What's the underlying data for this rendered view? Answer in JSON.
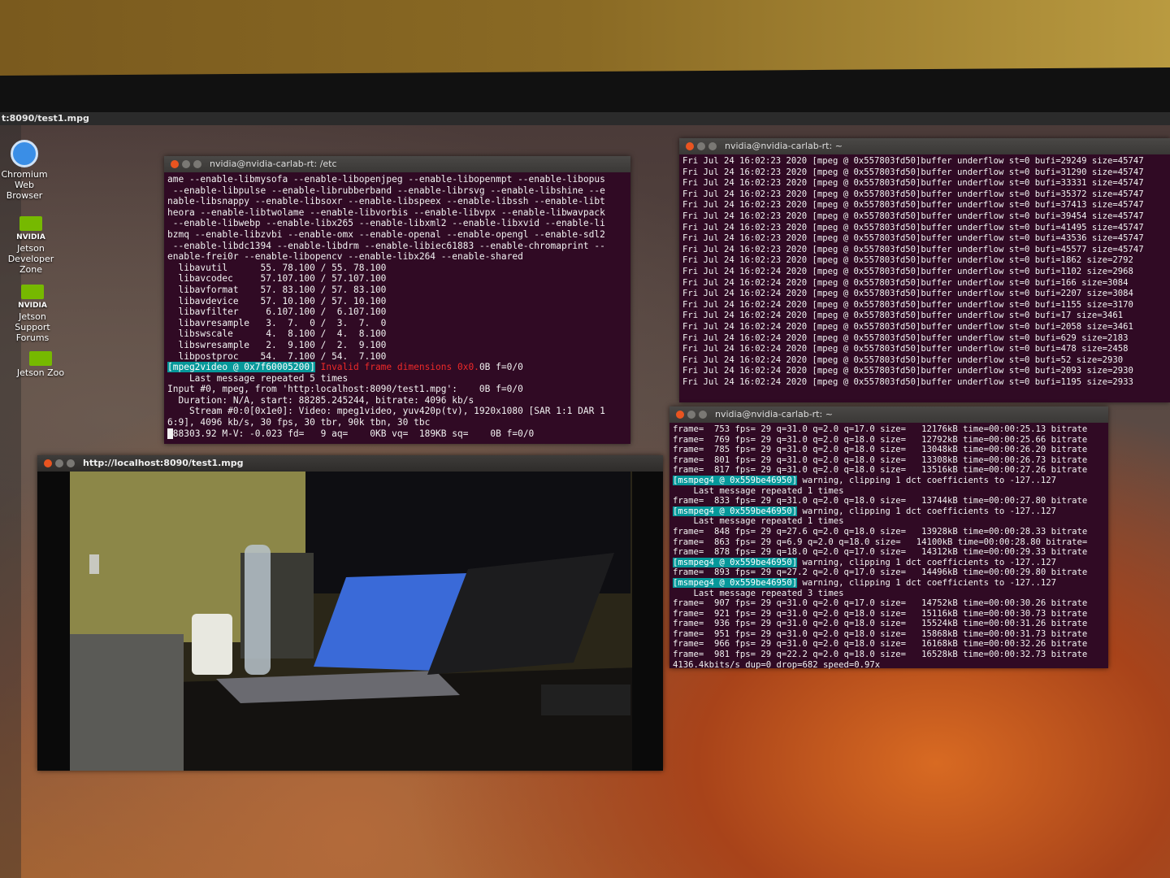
{
  "topbar": {
    "title": "t:8090/test1.mpg"
  },
  "desktop_icons": [
    {
      "label": "Chromium Web Browser",
      "icon": "chromium-icon"
    },
    {
      "label": "Jetson Developer Zone",
      "icon": "nvidia-icon",
      "brand": "NVIDIA"
    },
    {
      "label": "Jetson Support Forums",
      "icon": "nvidia-icon",
      "brand": "NVIDIA"
    },
    {
      "label": "Jetson Zoo",
      "icon": "nvidia-icon",
      "brand": "NVIDIA"
    }
  ],
  "terminal_etc": {
    "title": "nvidia@nvidia-carlab-rt: /etc",
    "lines": [
      "ame --enable-libmysofa --enable-libopenjpeg --enable-libopenmpt --enable-libopus",
      " --enable-libpulse --enable-librubberband --enable-librsvg --enable-libshine --e",
      "nable-libsnappy --enable-libsoxr --enable-libspeex --enable-libssh --enable-libt",
      "heora --enable-libtwolame --enable-libvorbis --enable-libvpx --enable-libwavpack",
      " --enable-libwebp --enable-libx265 --enable-libxml2 --enable-libxvid --enable-li",
      "bzmq --enable-libzvbi --enable-omx --enable-openal --enable-opengl --enable-sdl2",
      " --enable-libdc1394 --enable-libdrm --enable-libiec61883 --enable-chromaprint --",
      "enable-frei0r --enable-libopencv --enable-libx264 --enable-shared",
      "  libavutil      55. 78.100 / 55. 78.100",
      "  libavcodec     57.107.100 / 57.107.100",
      "  libavformat    57. 83.100 / 57. 83.100",
      "  libavdevice    57. 10.100 / 57. 10.100",
      "  libavfilter     6.107.100 /  6.107.100",
      "  libavresample   3.  7.  0 /  3.  7.  0",
      "  libswscale      4.  8.100 /  4.  8.100",
      "  libswresample   2.  9.100 /  2.  9.100",
      "  libpostproc    54.  7.100 / 54.  7.100"
    ],
    "error_tag": "[mpeg2video @ 0x7f60005200]",
    "error_msg": " Invalid frame dimensions 0x0.",
    "error_tail": "0B f=0/0",
    "lines2": [
      "    Last message repeated 5 times",
      "Input #0, mpeg, from 'http:localhost:8090/test1.mpg':    0B f=0/0",
      "  Duration: N/A, start: 88285.245244, bitrate: 4096 kb/s",
      "    Stream #0:0[0x1e0]: Video: mpeg1video, yuv420p(tv), 1920x1080 [SAR 1:1 DAR 1",
      "6:9], 4096 kb/s, 30 fps, 30 tbr, 90k tbn, 30 tbc"
    ],
    "last_line": "88303.92 M-V: -0.023 fd=   9 aq=    0KB vq=  189KB sq=    0B f=0/0"
  },
  "terminal_mpeg": {
    "title": "nvidia@nvidia-carlab-rt: ~",
    "lines": [
      "Fri Jul 24 16:02:23 2020 [mpeg @ 0x557803fd50]buffer underflow st=0 bufi=29249 size=45747",
      "Fri Jul 24 16:02:23 2020 [mpeg @ 0x557803fd50]buffer underflow st=0 bufi=31290 size=45747",
      "Fri Jul 24 16:02:23 2020 [mpeg @ 0x557803fd50]buffer underflow st=0 bufi=33331 size=45747",
      "Fri Jul 24 16:02:23 2020 [mpeg @ 0x557803fd50]buffer underflow st=0 bufi=35372 size=45747",
      "Fri Jul 24 16:02:23 2020 [mpeg @ 0x557803fd50]buffer underflow st=0 bufi=37413 size=45747",
      "Fri Jul 24 16:02:23 2020 [mpeg @ 0x557803fd50]buffer underflow st=0 bufi=39454 size=45747",
      "Fri Jul 24 16:02:23 2020 [mpeg @ 0x557803fd50]buffer underflow st=0 bufi=41495 size=45747",
      "Fri Jul 24 16:02:23 2020 [mpeg @ 0x557803fd50]buffer underflow st=0 bufi=43536 size=45747",
      "Fri Jul 24 16:02:23 2020 [mpeg @ 0x557803fd50]buffer underflow st=0 bufi=45577 size=45747",
      "Fri Jul 24 16:02:23 2020 [mpeg @ 0x557803fd50]buffer underflow st=0 bufi=1862 size=2792",
      "Fri Jul 24 16:02:24 2020 [mpeg @ 0x557803fd50]buffer underflow st=0 bufi=1102 size=2968",
      "Fri Jul 24 16:02:24 2020 [mpeg @ 0x557803fd50]buffer underflow st=0 bufi=166 size=3084",
      "Fri Jul 24 16:02:24 2020 [mpeg @ 0x557803fd50]buffer underflow st=0 bufi=2207 size=3084",
      "Fri Jul 24 16:02:24 2020 [mpeg @ 0x557803fd50]buffer underflow st=0 bufi=1155 size=3170",
      "Fri Jul 24 16:02:24 2020 [mpeg @ 0x557803fd50]buffer underflow st=0 bufi=17 size=3461",
      "Fri Jul 24 16:02:24 2020 [mpeg @ 0x557803fd50]buffer underflow st=0 bufi=2058 size=3461",
      "Fri Jul 24 16:02:24 2020 [mpeg @ 0x557803fd50]buffer underflow st=0 bufi=629 size=2183",
      "Fri Jul 24 16:02:24 2020 [mpeg @ 0x557803fd50]buffer underflow st=0 bufi=478 size=2458",
      "Fri Jul 24 16:02:24 2020 [mpeg @ 0x557803fd50]buffer underflow st=0 bufi=52 size=2930",
      "Fri Jul 24 16:02:24 2020 [mpeg @ 0x557803fd50]buffer underflow st=0 bufi=2093 size=2930",
      "Fri Jul 24 16:02:24 2020 [mpeg @ 0x557803fd50]buffer underflow st=0 bufi=1195 size=2933"
    ]
  },
  "terminal_encode": {
    "title": "nvidia@nvidia-carlab-rt: ~",
    "lines": [
      {
        "t": "frame=  753 fps= 29 q=31.0 q=2.0 q=17.0 size=   12176kB time=00:00:25.13 bitrate"
      },
      {
        "t": "frame=  769 fps= 29 q=31.0 q=2.0 q=18.0 size=   12792kB time=00:00:25.66 bitrate"
      },
      {
        "t": "frame=  785 fps= 29 q=31.0 q=2.0 q=18.0 size=   13048kB time=00:00:26.20 bitrate"
      },
      {
        "t": "frame=  801 fps= 29 q=31.0 q=2.0 q=18.0 size=   13308kB time=00:00:26.73 bitrate"
      },
      {
        "t": "frame=  817 fps= 29 q=31.0 q=2.0 q=18.0 size=   13516kB time=00:00:27.26 bitrate"
      },
      {
        "tag": "[msmpeg4 @ 0x559be46950]",
        "t": " warning, clipping 1 dct coefficients to -127..127"
      },
      {
        "t": "    Last message repeated 1 times"
      },
      {
        "t": "frame=  833 fps= 29 q=31.0 q=2.0 q=18.0 size=   13744kB time=00:00:27.80 bitrate"
      },
      {
        "tag": "[msmpeg4 @ 0x559be46950]",
        "t": " warning, clipping 1 dct coefficients to -127..127"
      },
      {
        "t": "    Last message repeated 1 times"
      },
      {
        "t": "frame=  848 fps= 29 q=27.6 q=2.0 q=18.0 size=   13928kB time=00:00:28.33 bitrate"
      },
      {
        "t": "frame=  863 fps= 29 q=6.9 q=2.0 q=18.0 size=   14100kB time=00:00:28.80 bitrate="
      },
      {
        "t": "frame=  878 fps= 29 q=18.0 q=2.0 q=17.0 size=   14312kB time=00:00:29.33 bitrate"
      },
      {
        "tag": "[msmpeg4 @ 0x559be46950]",
        "t": " warning, clipping 1 dct coefficients to -127..127"
      },
      {
        "t": "frame=  893 fps= 29 q=27.2 q=2.0 q=17.0 size=   14496kB time=00:00:29.80 bitrate"
      },
      {
        "tag": "[msmpeg4 @ 0x559be46950]",
        "t": " warning, clipping 1 dct coefficients to -127..127"
      },
      {
        "t": "    Last message repeated 3 times"
      },
      {
        "t": "frame=  907 fps= 29 q=31.0 q=2.0 q=17.0 size=   14752kB time=00:00:30.26 bitrate"
      },
      {
        "t": "frame=  921 fps= 29 q=31.0 q=2.0 q=18.0 size=   15116kB time=00:00:30.73 bitrate"
      },
      {
        "t": "frame=  936 fps= 29 q=31.0 q=2.0 q=18.0 size=   15524kB time=00:00:31.26 bitrate"
      },
      {
        "t": "frame=  951 fps= 29 q=31.0 q=2.0 q=18.0 size=   15868kB time=00:00:31.73 bitrate"
      },
      {
        "t": "frame=  966 fps= 29 q=31.0 q=2.0 q=18.0 size=   16168kB time=00:00:32.26 bitrate"
      },
      {
        "t": "frame=  981 fps= 29 q=22.2 q=2.0 q=18.0 size=   16528kB time=00:00:32.73 bitrate"
      }
    ],
    "last_line": "4136.4kbits/s dup=0 drop=682 speed=0.97x"
  },
  "video_window": {
    "title": "http://localhost:8090/test1.mpg"
  },
  "colors": {
    "terminal_bg": "#300a24",
    "highlight": "#06989a",
    "error": "#ef2929",
    "ubuntu_close": "#e95420",
    "nvidia_green": "#76b900"
  }
}
